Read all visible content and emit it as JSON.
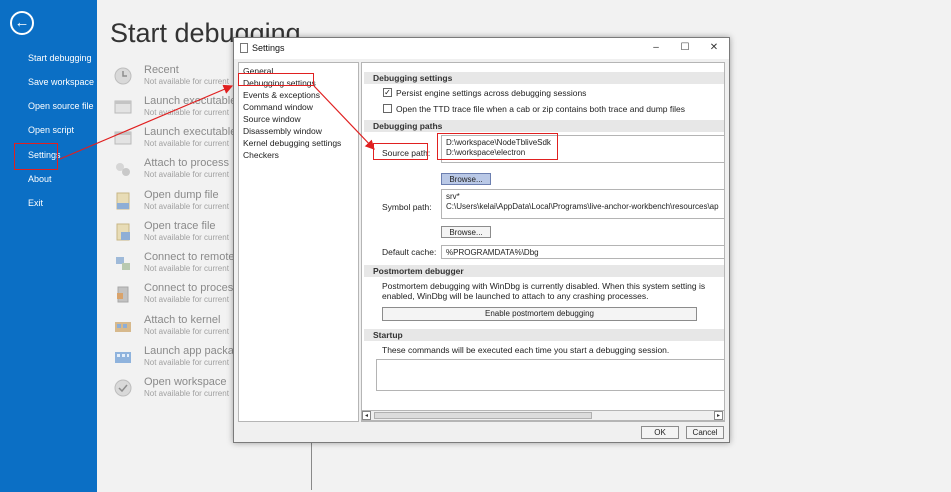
{
  "sidebar": {
    "back_icon": "arrow-left-circle-icon",
    "items": [
      {
        "id": "start-debugging",
        "label": "Start debugging"
      },
      {
        "id": "save-workspace",
        "label": "Save workspace"
      },
      {
        "id": "open-source-file",
        "label": "Open source file"
      },
      {
        "id": "open-script",
        "label": "Open script"
      },
      {
        "id": "settings",
        "label": "Settings"
      },
      {
        "id": "about",
        "label": "About"
      },
      {
        "id": "exit",
        "label": "Exit"
      }
    ]
  },
  "main": {
    "title": "Start debugging",
    "items": [
      {
        "title": "Recent",
        "subtitle": "Not available for current",
        "icon": "clock-icon"
      },
      {
        "title": "Launch executable",
        "subtitle": "Not available for current",
        "icon": "exe-icon"
      },
      {
        "title": "Launch executable",
        "subtitle": "Not available for current",
        "icon": "exe-icon"
      },
      {
        "title": "Attach to process",
        "subtitle": "Not available for current",
        "icon": "process-icon"
      },
      {
        "title": "Open dump file",
        "subtitle": "Not available for current",
        "icon": "dump-file-icon"
      },
      {
        "title": "Open trace file",
        "subtitle": "Not available for current",
        "icon": "trace-file-icon"
      },
      {
        "title": "Connect to remote",
        "subtitle": "Not available for current",
        "icon": "remote-icon"
      },
      {
        "title": "Connect to proces",
        "subtitle": "Not available for current",
        "icon": "process-server-icon"
      },
      {
        "title": "Attach to kernel",
        "subtitle": "Not available for current",
        "icon": "kernel-icon"
      },
      {
        "title": "Launch app packa",
        "subtitle": "Not available for current",
        "icon": "app-package-icon"
      },
      {
        "title": "Open workspace",
        "subtitle": "Not available for current",
        "icon": "workspace-icon"
      }
    ]
  },
  "dialog": {
    "title": "Settings",
    "window_buttons": {
      "minimize": "–",
      "maximize": "☐",
      "close": "✕"
    },
    "nav": [
      "General",
      "Debugging settings",
      "Events & exceptions",
      "Command window",
      "Source window",
      "Disassembly window",
      "Kernel debugging settings",
      "Checkers"
    ],
    "sections": {
      "debugging_settings": "Debugging settings",
      "debugging_paths": "Debugging paths",
      "postmortem": "Postmortem debugger",
      "startup": "Startup"
    },
    "checkboxes": [
      {
        "label": "Persist engine settings across debugging sessions",
        "checked": true,
        "mark": "✓"
      },
      {
        "label": "Open the TTD trace file when a cab or zip contains both trace and dump files",
        "checked": false,
        "mark": ""
      }
    ],
    "source_path": {
      "label": "Source path:",
      "lines": [
        "D:\\workspace\\NodeTbliveSdk",
        "D:\\workspace\\electron"
      ],
      "browse": "Browse..."
    },
    "symbol_path": {
      "label": "Symbol path:",
      "lines": [
        "srv*",
        "C:\\Users\\kelai\\AppData\\Local\\Programs\\live-anchor-workbench\\resources\\ap"
      ],
      "browse": "Browse..."
    },
    "default_cache": {
      "label": "Default cache:",
      "value": "%PROGRAMDATA%\\Dbg"
    },
    "postmortem_text_1": "Postmortem debugging with WinDbg is currently disabled. When this system setting is",
    "postmortem_text_2": "enabled, WinDbg will be launched to attach to any crashing processes.",
    "enable_postmortem": "Enable postmortem debugging",
    "startup_text": "These commands will be executed each time you start a debugging session.",
    "startup_commands": "",
    "scroll_left": "◂",
    "scroll_right": "▸",
    "ok": "OK",
    "cancel": "Cancel"
  },
  "colors": {
    "sidebar": "#0b6fc5",
    "annotation": "#e02020"
  }
}
